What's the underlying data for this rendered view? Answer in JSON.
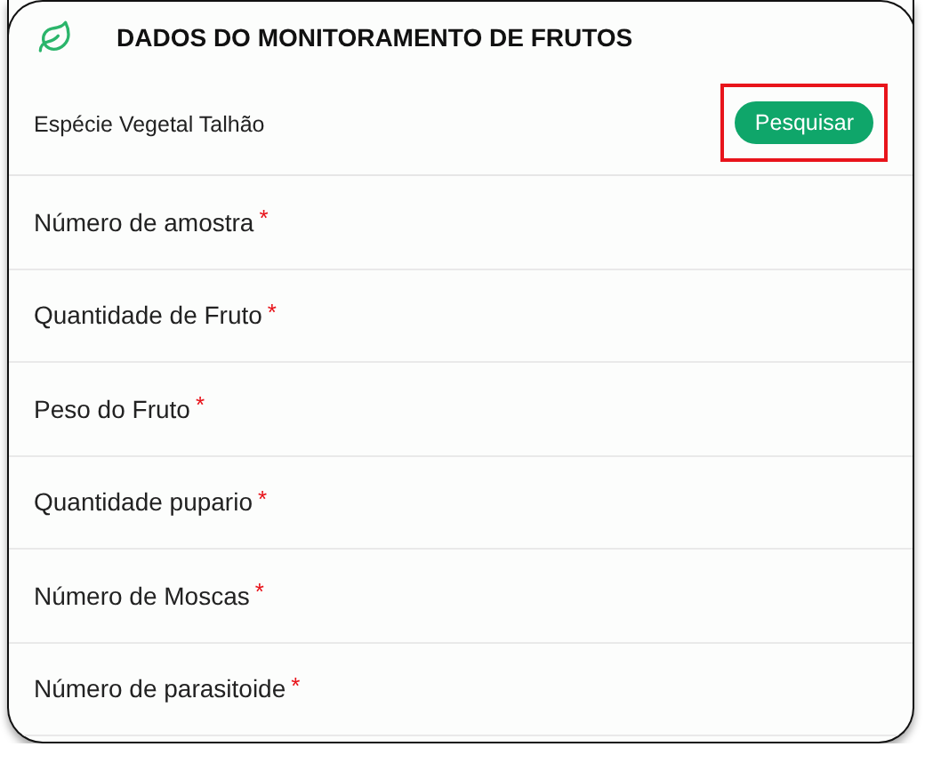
{
  "header": {
    "title": "DADOS DO MONITORAMENTO DE FRUTOS"
  },
  "search_row": {
    "label": "Espécie Vegetal Talhão",
    "button": {
      "label": "Pesquisar",
      "highlighted": true
    }
  },
  "fields": [
    {
      "label": "Número de amostra",
      "required_mark": "*"
    },
    {
      "label": "Quantidade de Fruto",
      "required_mark": "*"
    },
    {
      "label": "Peso do Fruto",
      "required_mark": "*"
    },
    {
      "label": "Quantidade pupario",
      "required_mark": "*"
    },
    {
      "label": "Número de Moscas",
      "required_mark": "*"
    },
    {
      "label": "Número de parasitoide",
      "required_mark": "*"
    }
  ]
}
